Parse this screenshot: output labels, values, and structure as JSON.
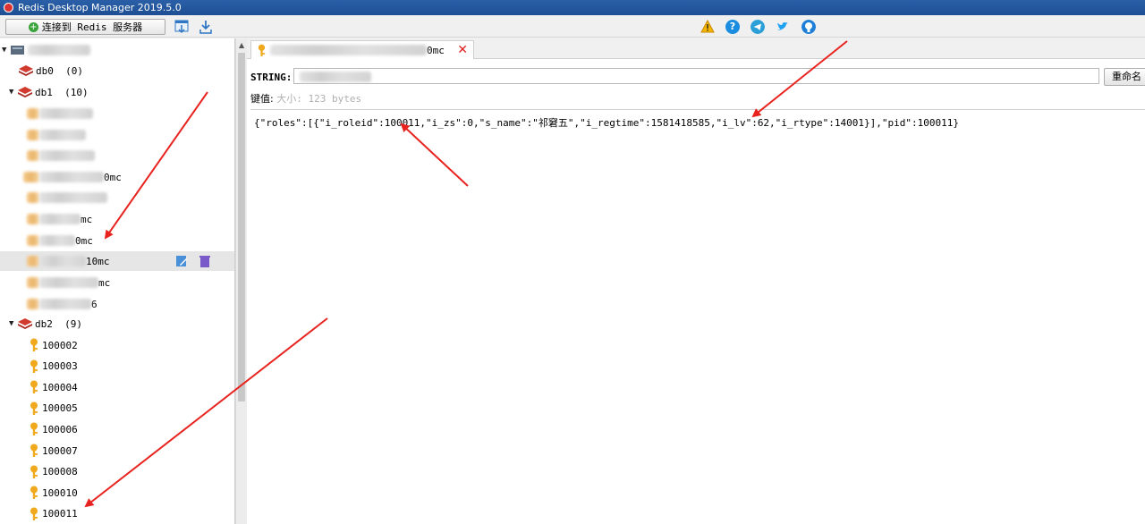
{
  "window": {
    "title": "Redis Desktop Manager 2019.5.0"
  },
  "toolbar": {
    "connect_label": "连接到 Redis 服务器"
  },
  "tree": {
    "db0": {
      "name": "db0",
      "count": "(0)"
    },
    "db1": {
      "name": "db1",
      "count": "(10)",
      "keys": [
        {
          "suffix": ""
        },
        {
          "suffix": ""
        },
        {
          "suffix": ""
        },
        {
          "suffix": "0mc"
        },
        {
          "suffix": ""
        },
        {
          "suffix": "mc"
        },
        {
          "suffix": "0mc"
        },
        {
          "suffix": "10mc"
        },
        {
          "suffix": "mc"
        },
        {
          "suffix": "6"
        }
      ]
    },
    "db2": {
      "name": "db2",
      "count": "(9)",
      "keys": [
        "100002",
        "100003",
        "100004",
        "100005",
        "100006",
        "100007",
        "100008",
        "100010",
        "100011"
      ]
    }
  },
  "editor": {
    "tab_suffix": "0mc",
    "type_label": "STRING:",
    "rename_label": "重命名",
    "size_label": "键值:",
    "size_value": "大小: 123 bytes",
    "value_part1": "{\"roles\":[{\"i_roleid\":100011,\"i_zs\":0,\"s_name\":\"",
    "value_cjk": "祁窘五",
    "value_part2": "\",\"i_regtime\":1581418585,\"i_lv\":62,\"i_rtype\":14001}],\"pid\":100011}"
  },
  "colors": {
    "arrow": "#e8231f",
    "db_icon": "#d13b2f",
    "key_icon": "#f0a81c",
    "titlebar": "#1e4f94"
  },
  "icons": [
    "warning-icon",
    "help-icon",
    "telegram-icon",
    "twitter-icon",
    "github-icon"
  ]
}
